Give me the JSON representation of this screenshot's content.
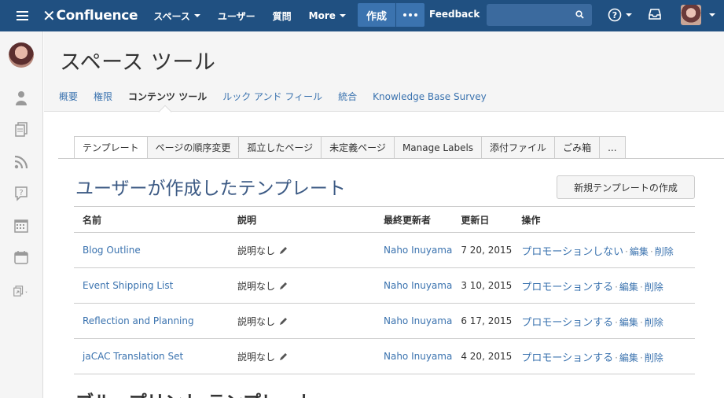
{
  "nav": {
    "logo": "Confluence",
    "links": [
      "スペース",
      "ユーザー",
      "質問",
      "More"
    ],
    "create_label": "作成",
    "feedback_label": "Feedback",
    "search_placeholder": ""
  },
  "page": {
    "title": "スペース ツール",
    "subnav": [
      "概要",
      "権限",
      "コンテンツ ツール",
      "ルック アンド フィール",
      "統合",
      "Knowledge Base Survey"
    ],
    "active_subnav": "コンテンツ ツール"
  },
  "tabs": [
    "テンプレート",
    "ページの順序変更",
    "孤立したページ",
    "未定義ページ",
    "Manage Labels",
    "添付ファイル",
    "ごみ箱",
    "..."
  ],
  "section": {
    "title": "ユーザーが作成したテンプレート",
    "new_button": "新規テンプレートの作成"
  },
  "table": {
    "headers": [
      "名前",
      "説明",
      "最終更新者",
      "更新日",
      "操作"
    ],
    "rows": [
      {
        "name": "Blog Outline",
        "desc": "説明なし",
        "updated_by": "Naho Inuyama",
        "date": "7 20, 2015",
        "promo": "プロモーションしない",
        "edit": "編集",
        "delete": "削除"
      },
      {
        "name": "Event Shipping List",
        "desc": "説明なし",
        "updated_by": "Naho Inuyama",
        "date": "3 10, 2015",
        "promo": "プロモーションする",
        "edit": "編集",
        "delete": "削除"
      },
      {
        "name": "Reflection and Planning",
        "desc": "説明なし",
        "updated_by": "Naho Inuyama",
        "date": "6 17, 2015",
        "promo": "プロモーションする",
        "edit": "編集",
        "delete": "削除"
      },
      {
        "name": "jaCAC Translation Set",
        "desc": "説明なし",
        "updated_by": "Naho Inuyama",
        "date": "4 20, 2015",
        "promo": "プロモーションする",
        "edit": "編集",
        "delete": "削除"
      }
    ]
  },
  "bottom_title": "ブループリント テンプレート",
  "colors": {
    "nav_bg": "#205081",
    "link": "#3b73af",
    "heading": "#3c5a84"
  }
}
